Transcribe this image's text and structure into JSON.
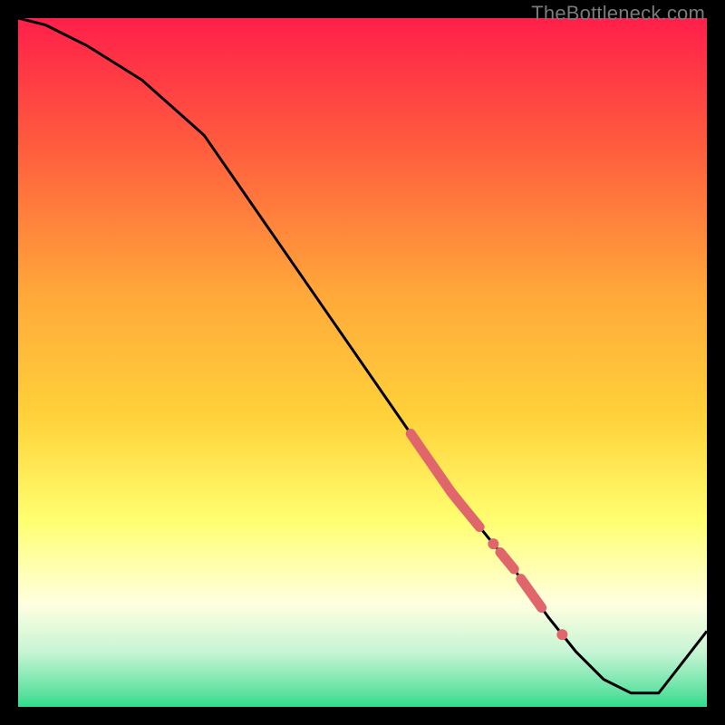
{
  "watermark": "TheBottleneck.com",
  "colors": {
    "bg_black": "#000000",
    "line_black": "#000000",
    "marker": "#e0666b",
    "grad_top": "#ff1f4a",
    "grad_mid1": "#ff6a3a",
    "grad_mid2": "#ffd23a",
    "grad_mid3": "#ffff70",
    "grad_pale": "#ffffe0",
    "grad_green_pale": "#c7f5d5",
    "grad_green": "#2edc8a"
  },
  "chart_data": {
    "type": "line",
    "title": "",
    "xlabel": "",
    "ylabel": "",
    "xlim": [
      0,
      100
    ],
    "ylim": [
      0,
      100
    ],
    "grid": false,
    "legend": false,
    "x": [
      0,
      4,
      10,
      18,
      27,
      36,
      45,
      54,
      63,
      72,
      77,
      81,
      85,
      89,
      93,
      100
    ],
    "values": [
      100,
      99,
      96,
      91,
      83,
      70,
      57,
      44,
      31,
      20,
      13,
      8,
      4,
      2,
      2,
      11
    ],
    "highlighted_segments": [
      {
        "x_start": 57,
        "x_end": 67
      },
      {
        "x_start": 70,
        "x_end": 72
      },
      {
        "x_start": 73,
        "x_end": 76
      }
    ],
    "highlighted_points_x": [
      69,
      79
    ]
  }
}
